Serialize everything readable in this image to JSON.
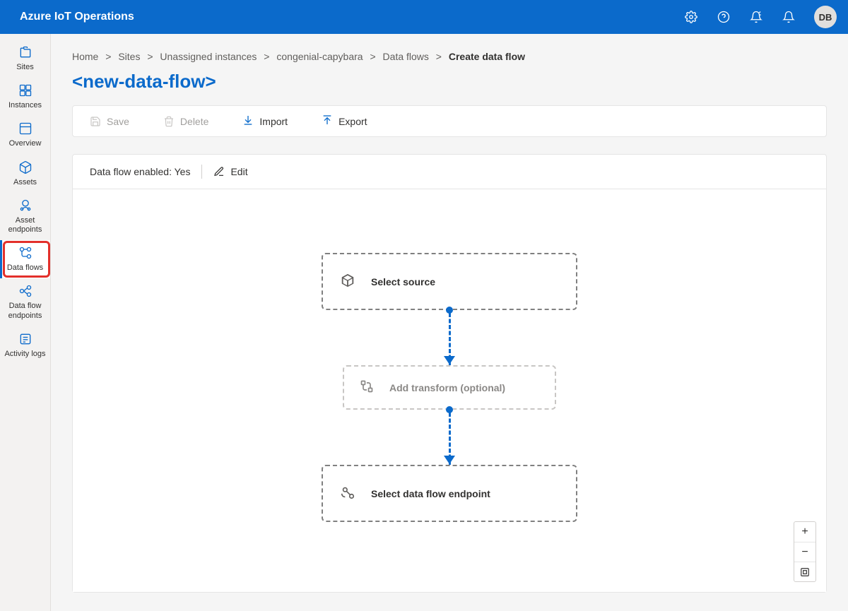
{
  "header": {
    "brand": "Azure IoT Operations",
    "avatar": "DB"
  },
  "sidebar": {
    "items": [
      {
        "label": "Sites"
      },
      {
        "label": "Instances"
      },
      {
        "label": "Overview"
      },
      {
        "label": "Assets"
      },
      {
        "label": "Asset endpoints"
      },
      {
        "label": "Data flows"
      },
      {
        "label": "Data flow endpoints"
      },
      {
        "label": "Activity logs"
      }
    ],
    "active_index": 5
  },
  "breadcrumbs": {
    "items": [
      "Home",
      "Sites",
      "Unassigned instances",
      "congenial-capybara",
      "Data flows"
    ],
    "current": "Create data flow"
  },
  "page": {
    "title": "<new-data-flow>"
  },
  "toolbar": {
    "save": "Save",
    "delete": "Delete",
    "import": "Import",
    "export": "Export"
  },
  "enabled_bar": {
    "status_label": "Data flow enabled: Yes",
    "edit": "Edit"
  },
  "flow": {
    "source": "Select source",
    "transform": "Add transform (optional)",
    "destination": "Select data flow endpoint"
  },
  "zoom": {
    "in": "+",
    "out": "−",
    "fit": "⛶"
  }
}
